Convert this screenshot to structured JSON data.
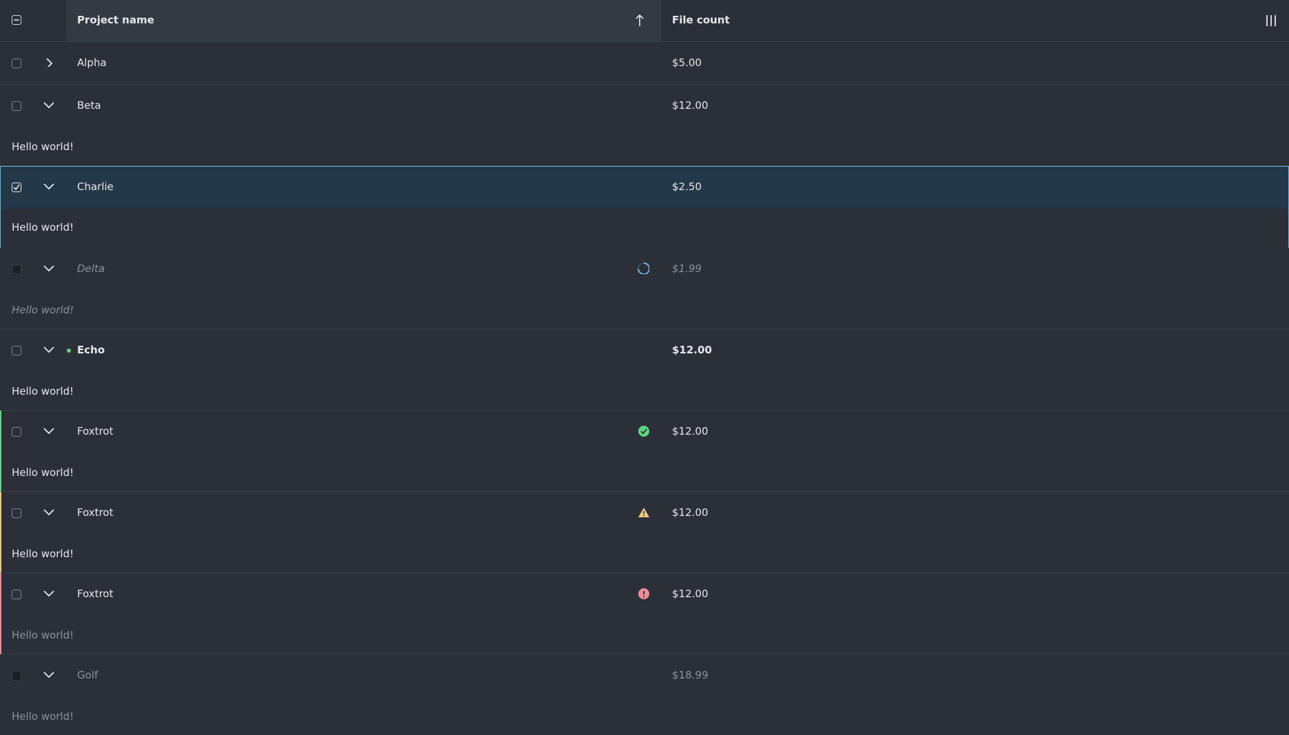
{
  "header": {
    "col_name": "Project name",
    "col_count": "File count",
    "sort_icon": "arrow-up-icon",
    "columns_icon": "columns-icon"
  },
  "rows": [
    {
      "name": "Alpha",
      "count": "$5.00",
      "expanded": false
    },
    {
      "name": "Beta",
      "count": "$12.00",
      "detail": "Hello world!"
    },
    {
      "name": "Charlie",
      "count": "$2.50",
      "detail": "Hello world!",
      "selected": true
    },
    {
      "name": "Delta",
      "count": "$1.99",
      "detail": "Hello world!",
      "state": "loading"
    },
    {
      "name": "Echo",
      "count": "$12.00",
      "detail": "Hello world!",
      "state": "new"
    },
    {
      "name": "Foxtrot",
      "count": "$12.00",
      "detail": "Hello world!",
      "state": "success"
    },
    {
      "name": "Foxtrot",
      "count": "$12.00",
      "detail": "Hello world!",
      "state": "warning"
    },
    {
      "name": "Foxtrot",
      "count": "$12.00",
      "detail": "Hello world!",
      "state": "error"
    },
    {
      "name": "Golf",
      "count": "$18.99",
      "detail": "Hello world!",
      "state": "disabled"
    }
  ],
  "colors": {
    "background": "#2b3038",
    "selected": "#23394a",
    "selected_border": "#6cb6e0",
    "success": "#5cd67a",
    "warning": "#f3c97d",
    "error": "#ef8c99",
    "loading": "#6cb6e0"
  }
}
